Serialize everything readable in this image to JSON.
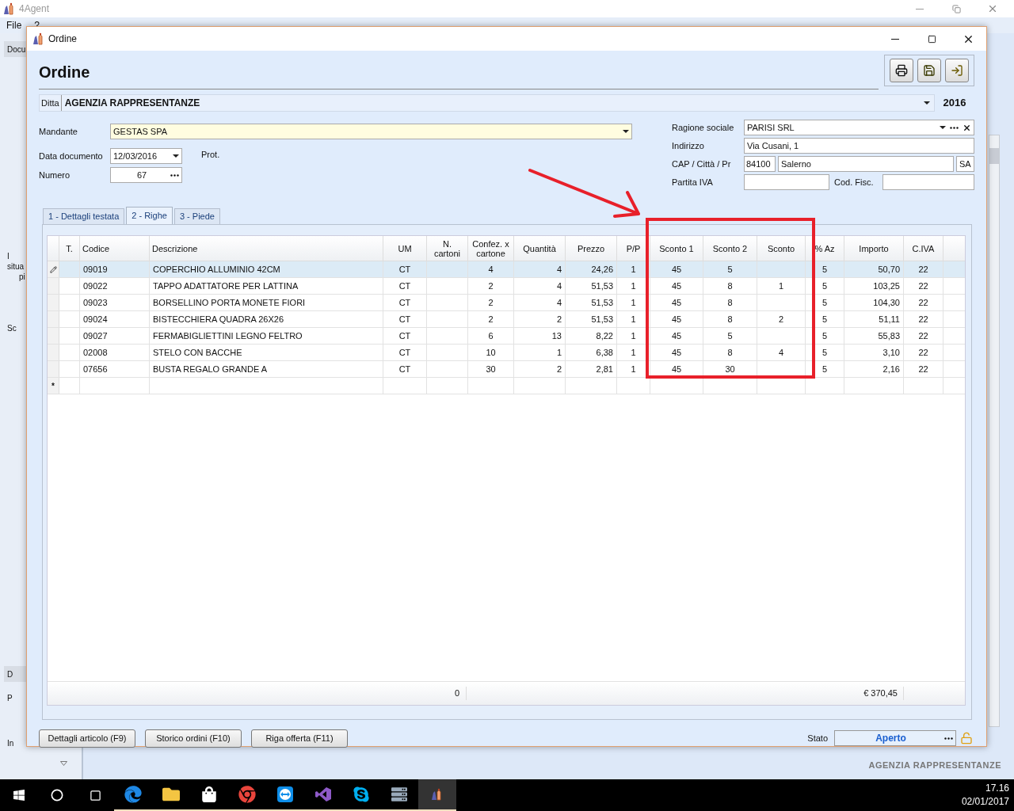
{
  "app": {
    "title": "4Agent",
    "menu": [
      "File",
      "?"
    ],
    "sidebar_texts": [
      {
        "text": "Docu",
        "kind": "header"
      },
      {
        "text": "I",
        "kind": "plain"
      },
      {
        "text": "situa",
        "kind": "plain"
      },
      {
        "text": "pi",
        "kind": "indent"
      },
      {
        "text": "Sc",
        "kind": "plain"
      },
      {
        "text": "D",
        "kind": "header"
      },
      {
        "text": "P",
        "kind": "plain"
      },
      {
        "text": "In",
        "kind": "plain"
      }
    ],
    "footer_brand": "AGENZIA RAPPRESENTANZE"
  },
  "dialog": {
    "title": "Ordine",
    "heading": "Ordine",
    "ditta": {
      "label": "Ditta",
      "value": "AGENZIA RAPPRESENTANZE"
    },
    "year": "2016",
    "mandante": {
      "label": "Mandante",
      "value": "GESTAS SPA"
    },
    "data_documento": {
      "label": "Data documento",
      "value": "12/03/2016"
    },
    "prot": {
      "label": "Prot."
    },
    "numero": {
      "label": "Numero",
      "value": "67"
    },
    "ragione_sociale": {
      "label": "Ragione sociale",
      "value": "PARISI SRL"
    },
    "indirizzo": {
      "label": "Indirizzo",
      "value": "Via Cusani, 1"
    },
    "cap_citta_pr": {
      "label": "CAP / Città / Pr",
      "cap": "84100",
      "citta": "Salerno",
      "pr": "SA"
    },
    "partita_iva": {
      "label": "Partita IVA"
    },
    "cod_fisc": {
      "label": "Cod. Fisc."
    },
    "tabs": [
      {
        "label": "1 - Dettagli testata",
        "selected": false
      },
      {
        "label": "2 - Righe",
        "selected": true
      },
      {
        "label": "3 - Piede",
        "selected": false
      }
    ],
    "table": {
      "columns": [
        "T.",
        "Codice",
        "Descrizione",
        "UM",
        "N. cartoni",
        "Confez. x cartone",
        "Quantità",
        "Prezzo",
        "P/P",
        "Sconto 1",
        "Sconto 2",
        "Sconto",
        "% Az",
        "Importo",
        "C.IVA"
      ],
      "rows": [
        {
          "selected": true,
          "codice": "09019",
          "descrizione": "COPERCHIO ALLUMINIO 42CM",
          "um": "CT",
          "confez": "4",
          "quantita": "4",
          "prezzo": "24,26",
          "pp": "1",
          "sconto1": "45",
          "sconto2": "5",
          "az": "5",
          "importo": "50,70",
          "iva": "22"
        },
        {
          "selected": false,
          "codice": "09022",
          "descrizione": "TAPPO ADATTATORE PER LATTINA",
          "um": "CT",
          "confez": "2",
          "quantita": "4",
          "prezzo": "51,53",
          "pp": "1",
          "sconto1": "45",
          "sconto2": "8",
          "sconto": "1",
          "az": "5",
          "importo": "103,25",
          "iva": "22"
        },
        {
          "selected": false,
          "codice": "09023",
          "descrizione": "BORSELLINO PORTA MONETE FIORI",
          "um": "CT",
          "confez": "2",
          "quantita": "4",
          "prezzo": "51,53",
          "pp": "1",
          "sconto1": "45",
          "sconto2": "8",
          "az": "5",
          "importo": "104,30",
          "iva": "22"
        },
        {
          "selected": false,
          "codice": "09024",
          "descrizione": "BISTECCHIERA QUADRA 26X26",
          "um": "CT",
          "confez": "2",
          "quantita": "2",
          "prezzo": "51,53",
          "pp": "1",
          "sconto1": "45",
          "sconto2": "8",
          "sconto": "2",
          "az": "5",
          "importo": "51,11",
          "iva": "22"
        },
        {
          "selected": false,
          "codice": "09027",
          "descrizione": "FERMABIGLIETTINI LEGNO FELTRO",
          "um": "CT",
          "confez": "6",
          "quantita": "13",
          "prezzo": "8,22",
          "pp": "1",
          "sconto1": "45",
          "sconto2": "5",
          "az": "5",
          "importo": "55,83",
          "iva": "22"
        },
        {
          "selected": false,
          "codice": "02008",
          "descrizione": "STELO CON BACCHE",
          "um": "CT",
          "confez": "10",
          "quantita": "1",
          "prezzo": "6,38",
          "pp": "1",
          "sconto1": "45",
          "sconto2": "8",
          "sconto": "4",
          "az": "5",
          "importo": "3,10",
          "iva": "22"
        },
        {
          "selected": false,
          "codice": "07656",
          "descrizione": "BUSTA REGALO GRANDE A",
          "um": "CT",
          "confez": "30",
          "quantita": "2",
          "prezzo": "2,81",
          "pp": "1",
          "sconto1": "45",
          "sconto2": "30",
          "az": "5",
          "importo": "2,16",
          "iva": "22"
        }
      ],
      "new_row_marker": "*",
      "totals": {
        "n_cartoni": "0",
        "importo": "€ 370,45"
      }
    },
    "buttons": [
      "Dettagli articolo (F9)",
      "Storico ordini (F10)",
      "Riga offerta (F11)"
    ],
    "stato": {
      "label": "Stato",
      "value": "Aperto"
    }
  },
  "taskbar": {
    "time": "17.16",
    "date": "02/01/2017"
  }
}
